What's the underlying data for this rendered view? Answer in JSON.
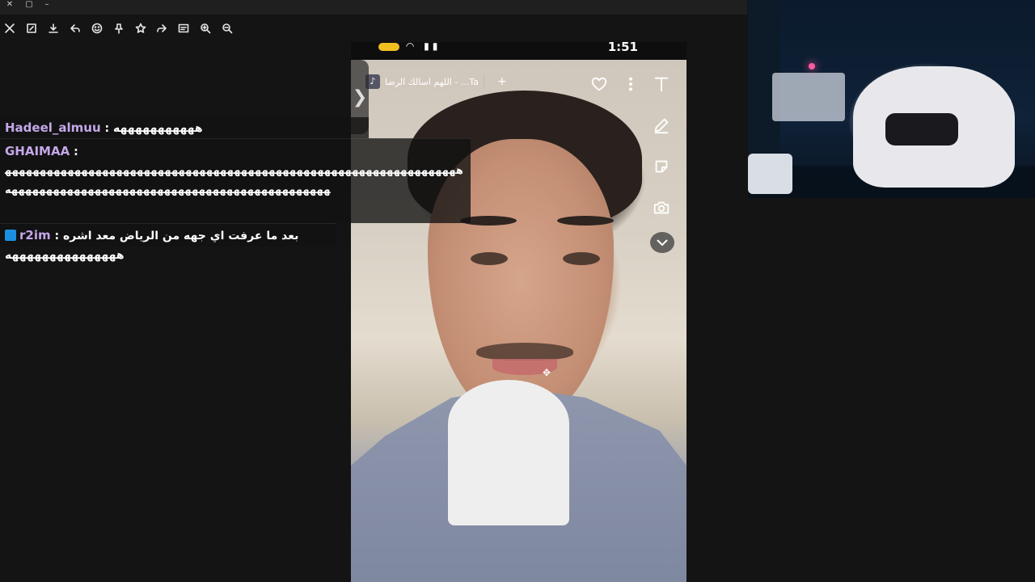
{
  "window": {
    "controls": {
      "close": "✕",
      "restore": "▢",
      "minimize": "–"
    }
  },
  "toolbar": {
    "icons": [
      "close-icon",
      "resize-icon",
      "download-icon",
      "reply-icon",
      "emoji-icon",
      "pin-icon",
      "star-icon",
      "forward-icon",
      "caption-icon",
      "zoom-in-icon",
      "zoom-out-icon"
    ]
  },
  "phone": {
    "status_time": "1:51",
    "music": {
      "title": "اللهم اسالك الرضا - ...Ta",
      "add": "+"
    },
    "side_arrow": "❯"
  },
  "chat": {
    "messages": [
      {
        "user": "Hadeel_almuu",
        "separator": " : ",
        "text": "هههههههههههه"
      },
      {
        "user": "GHAIMAA",
        "separator": " :",
        "text": "ههههههههههههههههههههههههههههههههههههههههههههههههههههههههههههههههههههههههههههههههههههههههههههههههههههههههههههههههه"
      },
      {
        "user": "r2im",
        "separator": " : ",
        "text": "بعد ما عرفت اي جهه من الرياض معد اشره هههههههههههههههه",
        "has_badge": true
      }
    ]
  },
  "colors": {
    "username": "#c4a7e8",
    "badge": "#1c8fe0",
    "background": "#141414"
  }
}
